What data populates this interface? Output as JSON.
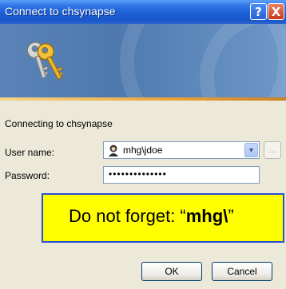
{
  "window": {
    "title": "Connect to chsynapse"
  },
  "titlebar": {
    "help_glyph": "?",
    "close_glyph": "X"
  },
  "dialog": {
    "connecting_text": "Connecting to chsynapse",
    "user_label": "User name:",
    "user_value": "mhg\\jdoe",
    "password_label": "Password:",
    "password_mask": "••••••••••••••",
    "browse_label": "...",
    "dropdown_glyph": "▼"
  },
  "callout": {
    "prefix": "Do not forget: “",
    "bold": "mhg\\",
    "suffix": "”"
  },
  "buttons": {
    "ok": "OK",
    "cancel": "Cancel"
  },
  "icons": {
    "banner": "keys-icon",
    "user": "user-icon"
  },
  "colors": {
    "titlebar": "#1c5fd6",
    "dialog_bg": "#ece9d8",
    "callout_bg": "#ffff00",
    "callout_border": "#2a4fd0"
  }
}
